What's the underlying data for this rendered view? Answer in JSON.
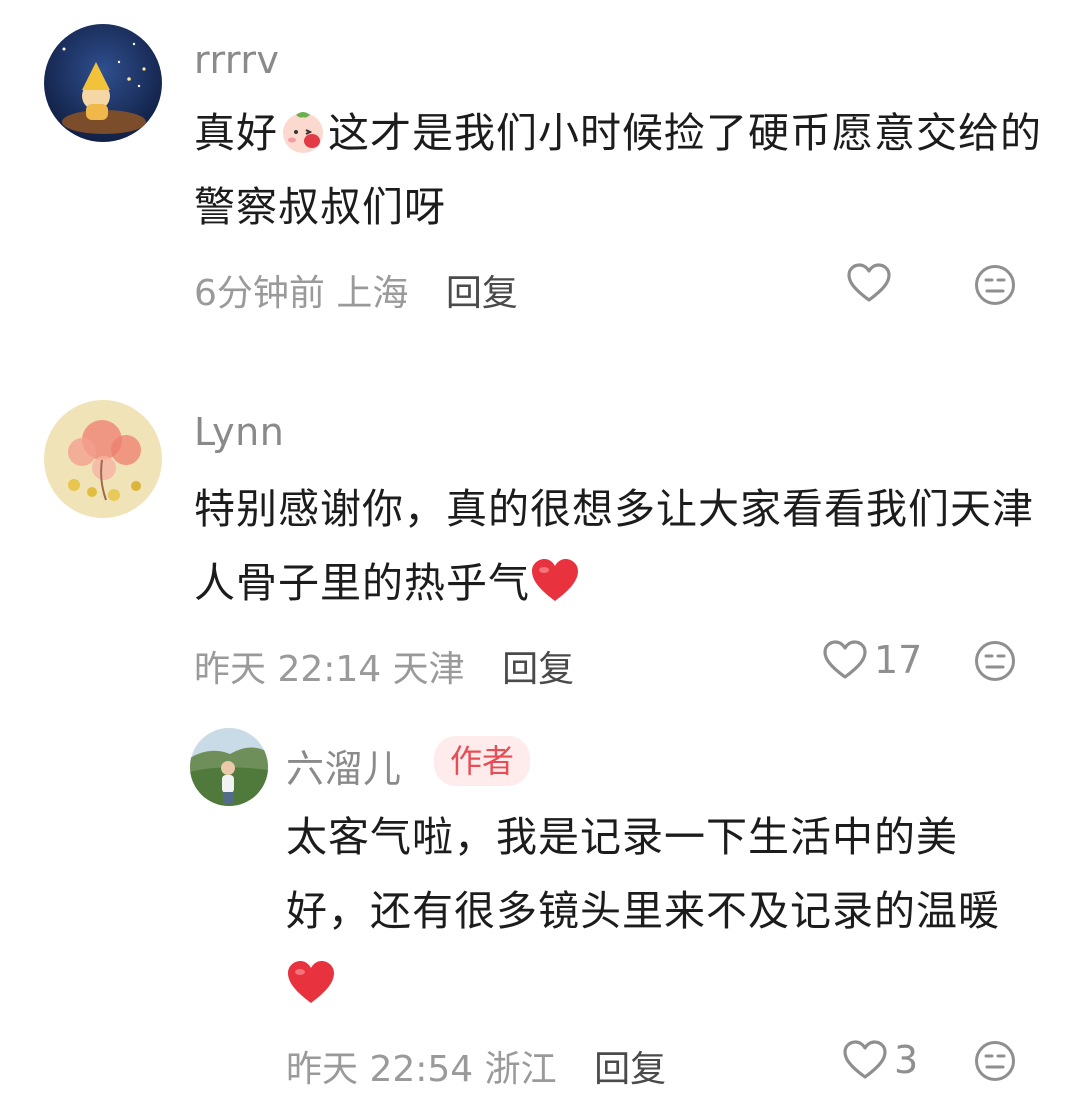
{
  "comments": [
    {
      "username": "rrrrv",
      "text_1": "真好",
      "text_2": "这才是我们小时候捡了硬币愿意交给的警察叔叔们呀",
      "time": "6分钟前",
      "location": "上海",
      "reply_label": "回复",
      "likes": ""
    },
    {
      "username": "Lynn",
      "text_1": "特别感谢你，真的很想多让大家看看我们天津人骨子里的热乎气",
      "time": "昨天 22:14",
      "location": "天津",
      "reply_label": "回复",
      "likes": "17"
    }
  ],
  "reply": {
    "username": "六溜儿",
    "badge": "作者",
    "text_1": "太客气啦，我是记录一下生活中的美好，还有很多镜头里来不及记录的温暖",
    "time": "昨天 22:54",
    "location": "浙江",
    "reply_label": "回复",
    "likes": "3"
  },
  "icons": {
    "like": "heart-outline-icon",
    "dislike": "meh-face-icon",
    "emoji_1": "blushing-peach-emoji",
    "emoji_2": "red-heart-emoji"
  },
  "colors": {
    "badge_bg": "#fdeceb",
    "badge_text": "#e84d55",
    "meta": "#9a9a9a",
    "heart": "#e8333f"
  }
}
